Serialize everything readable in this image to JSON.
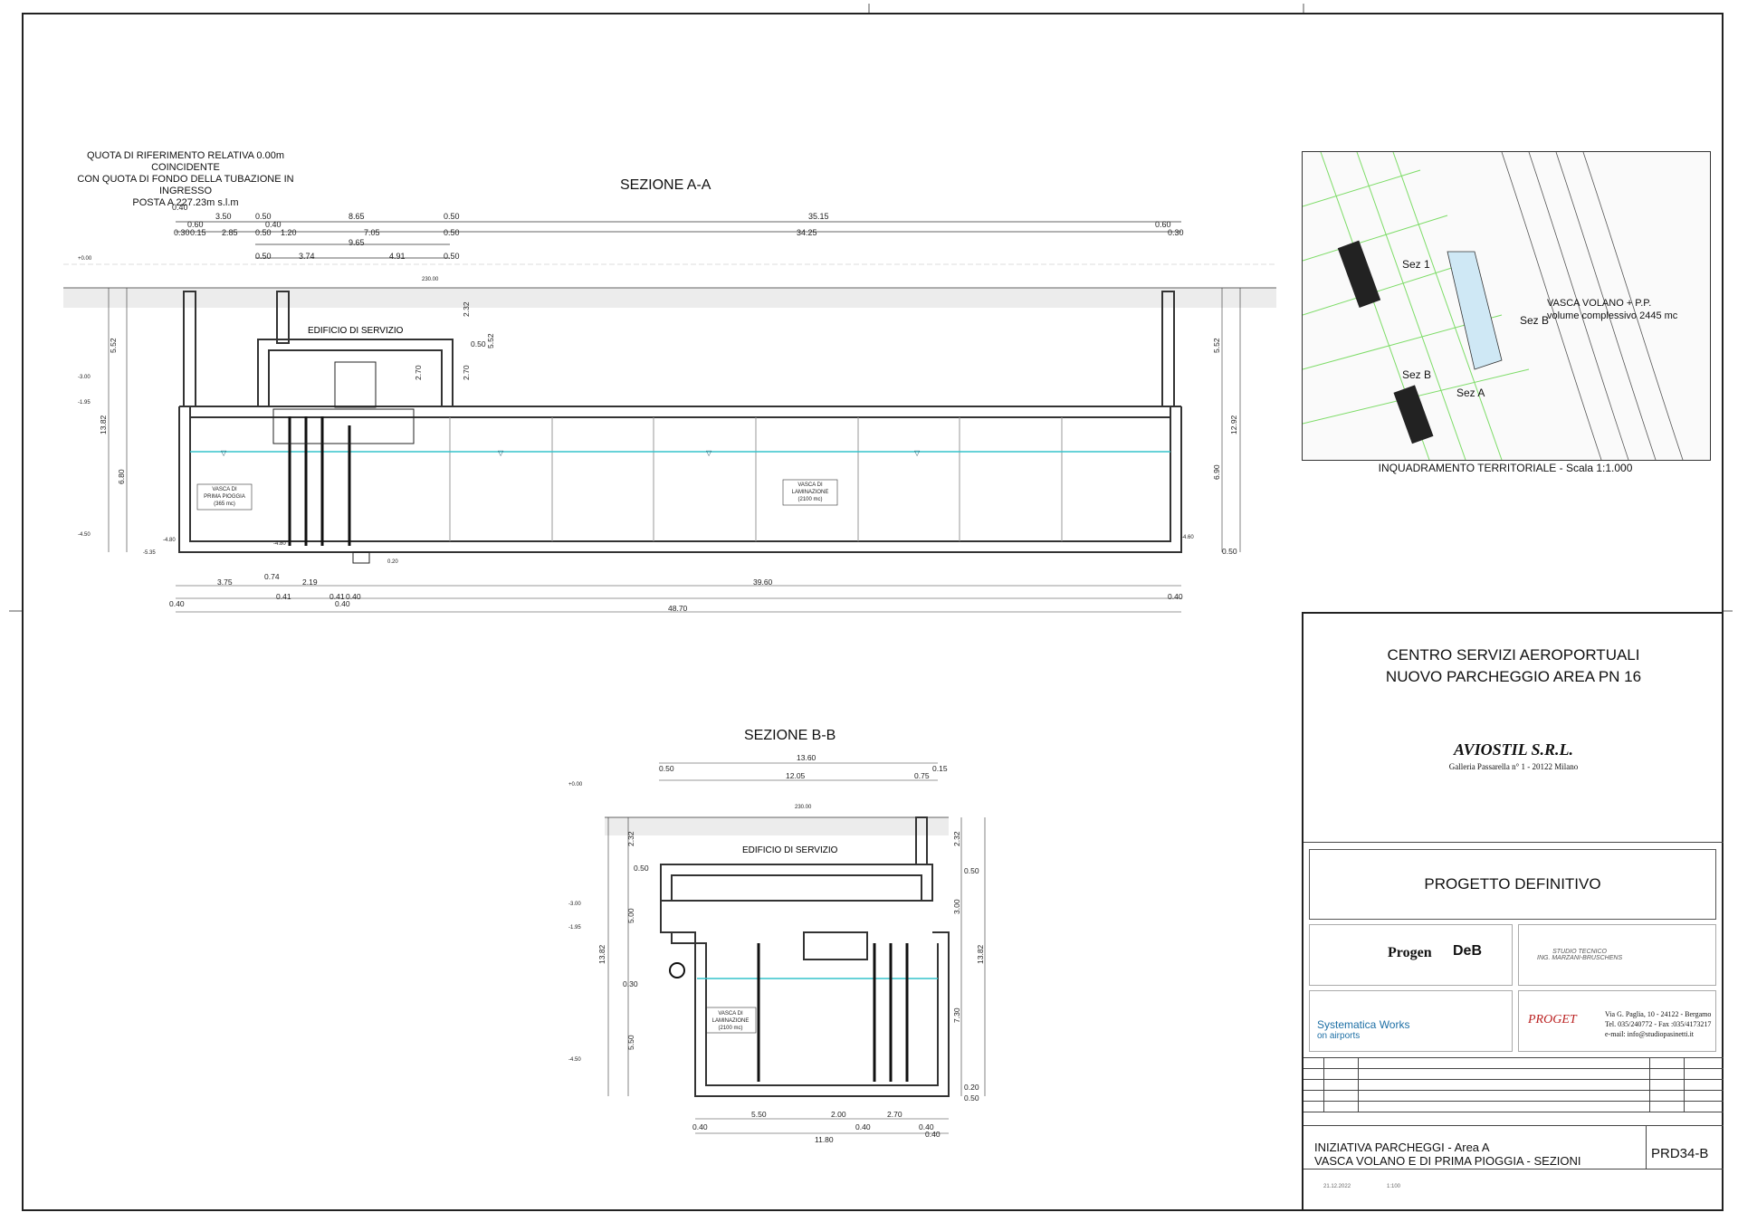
{
  "reference_note": [
    "QUOTA DI RIFERIMENTO RELATIVA 0.00m COINCIDENTE",
    "CON QUOTA DI FONDO DELLA TUBAZIONE IN INGRESSO",
    "POSTA A 227.23m s.l.m"
  ],
  "section_aa": {
    "title": "SEZIONE A-A",
    "building_label": "EDIFICIO DI SERVIZIO",
    "tank1_label": [
      "VASCA DI",
      "PRIMA PIOGGIA",
      "(365 mc)"
    ],
    "tank2_label": [
      "VASCA DI",
      "LAMINAZIONE",
      "(2100 mc)"
    ],
    "top_dims_row1": [
      "0.40",
      "3.50",
      "0.50",
      "8.65",
      "0.50",
      "35.15"
    ],
    "top_dims_row2": [
      "0.60",
      "0.40"
    ],
    "top_dims_row3": [
      "0.30",
      "0.15",
      "2.85",
      "0.50",
      "1.20",
      "7.05",
      "0.50",
      "34.25",
      "0.60",
      "0.30"
    ],
    "top_dims_row4": [
      "9.65"
    ],
    "top_dims_row5": [
      "0.50",
      "3.74",
      "4.91",
      "0.50"
    ],
    "bottom_dims_row1": [
      "3.75",
      "0.74",
      "2.19",
      "39.60"
    ],
    "bottom_dims_row2": [
      "0.41",
      "0.41",
      "0.40"
    ],
    "bottom_dims_row3": [
      "0.40",
      "0.40",
      "48.70",
      "0.40"
    ],
    "left_dims": [
      "5.52",
      "13.82",
      "6.80"
    ],
    "right_dims": [
      "5.52",
      "12.92",
      "6.90",
      "0.50"
    ],
    "inner_dims": [
      "2.32",
      "0.50",
      "2.70",
      "2.70",
      "5.52"
    ],
    "levels": [
      "+0.00",
      "-3.00",
      "-1.95",
      "-4.50",
      "-5.35",
      "-4.80",
      "-4.60",
      "-4.80",
      "0.20"
    ],
    "ground_level": "230.00"
  },
  "section_bb": {
    "title": "SEZIONE B-B",
    "building_label": "EDIFICIO DI SERVIZIO",
    "tank_label": [
      "VASCA DI",
      "LAMINAZIONE",
      "(2100 mc)"
    ],
    "top_dims": [
      "13.60",
      "0.50",
      "12.05",
      "0.75",
      "0.15"
    ],
    "bottom_dims": [
      "5.50",
      "2.00",
      "2.70",
      "0.40",
      "0.40",
      "0.40",
      "11.80",
      "0.40"
    ],
    "left_dims": [
      "2.32",
      "0.50",
      "5.00",
      "13.82",
      "0.30",
      "5.50"
    ],
    "right_dims": [
      "2.32",
      "0.50",
      "3.00",
      "13.82",
      "7.30",
      "0.20",
      "0.50"
    ],
    "levels": [
      "+0.00",
      "-3.00",
      "-1.95",
      "-4.50"
    ],
    "ground_level": "230.00"
  },
  "map": {
    "caption": "INQUADRAMENTO TERRITORIALE - Scala 1:1.000",
    "labels": [
      "Sez 1",
      "Sez B",
      "Sez B",
      "Sez A"
    ],
    "tank_label": [
      "VASCA VOLANO + P.P.",
      "volume complessivo 2445 mc"
    ]
  },
  "title_block": {
    "project_line1": "CENTRO SERVIZI AEROPORTUALI",
    "project_line2": "NUOVO PARCHEGGIO AREA PN 16",
    "client": "AVIOSTIL S.R.L.",
    "client_address": "Galleria Passarella n° 1 - 20122 Milano",
    "phase": "PROGETTO DEFINITIVO",
    "firm1": "Progen",
    "firm2": "DeB",
    "firm3_line1": "STUDIO TECNICO",
    "firm3_line2": "ING. MARZANI-BRUSCHENS",
    "firm4_line1": "Systematica Works",
    "firm4_line2": "on airports",
    "firm5": "PROGET",
    "firm5_address": [
      "Via G. Paglia, 10 - 24122 - Bergamo",
      "Tel. 035/240772 - Fax :035/4173217",
      "e-mail: info@studiopasinetti.it"
    ],
    "drawing_title_line1": "INIZIATIVA PARCHEGGI - Area A",
    "drawing_title_line2": "VASCA VOLANO E DI PRIMA PIOGGIA - SEZIONI",
    "drawing_number": "PRD34-B",
    "date": "21.12.2022",
    "scale": "1:100"
  }
}
